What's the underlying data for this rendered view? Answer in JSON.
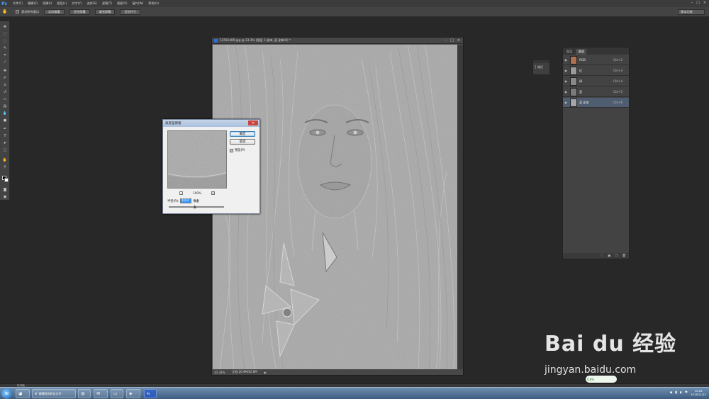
{
  "app": {
    "logo": "Ps",
    "menus": [
      "文件(F)",
      "编辑(E)",
      "图像(I)",
      "图层(L)",
      "文字(Y)",
      "选择(S)",
      "滤镜(T)",
      "视图(V)",
      "窗口(W)",
      "帮助(H)"
    ],
    "window_controls": [
      "–",
      "□",
      "×"
    ]
  },
  "options_bar": {
    "checkbox_label": "滚动所有窗口",
    "buttons": [
      "实际像素",
      "适合屏幕",
      "填充屏幕",
      "打印尺寸"
    ],
    "workspace": "基本功能"
  },
  "document": {
    "title": "13591489.jpg @ 33.3% (图层 1 副本, 蓝 副本/8) *",
    "zoom": "33.33%",
    "doc_size": "文档:26.9M/82.8M",
    "controls": [
      "–",
      "□",
      "×"
    ]
  },
  "dialog": {
    "title": "高反差保留",
    "ok": "确定",
    "cancel": "取消",
    "preview_label": "预览(P)",
    "preview_checked": "✓",
    "zoom_out": "–",
    "zoom_in": "+",
    "zoom_percent": "100%",
    "radius_label": "半径(R):",
    "radius_value": "10.0",
    "radius_unit": "像素",
    "slider_position": 0.47
  },
  "mini_panel": {
    "label": "路径"
  },
  "channels_panel": {
    "tabs": [
      "图层",
      "通道"
    ],
    "active_tab": 1,
    "rows": [
      {
        "name": "RGB",
        "key": "Ctrl+2",
        "selected": false
      },
      {
        "name": "红",
        "key": "Ctrl+3",
        "selected": false
      },
      {
        "name": "绿",
        "key": "Ctrl+4",
        "selected": false
      },
      {
        "name": "蓝",
        "key": "Ctrl+5",
        "selected": false
      },
      {
        "name": "蓝 副本",
        "key": "Ctrl+6",
        "selected": true
      }
    ]
  },
  "mini_bridge": {
    "label": "时间轴"
  },
  "taskbar": {
    "apps": [
      {
        "label": "捷捷网页转长文件"
      },
      {
        "label": ""
      },
      {
        "label": ""
      },
      {
        "label": ""
      },
      {
        "label": ""
      },
      {
        "label": "Ps"
      }
    ],
    "time": "19:28",
    "date": "2018/11/22"
  },
  "watermark": {
    "logo": "Bai du 经验",
    "url": "jingyan.baidu.com",
    "badge": "0.8%"
  },
  "colors": {
    "accent": "#3399ff",
    "canvas_gray": "#a6a6a6",
    "panel_bg": "#434343"
  }
}
